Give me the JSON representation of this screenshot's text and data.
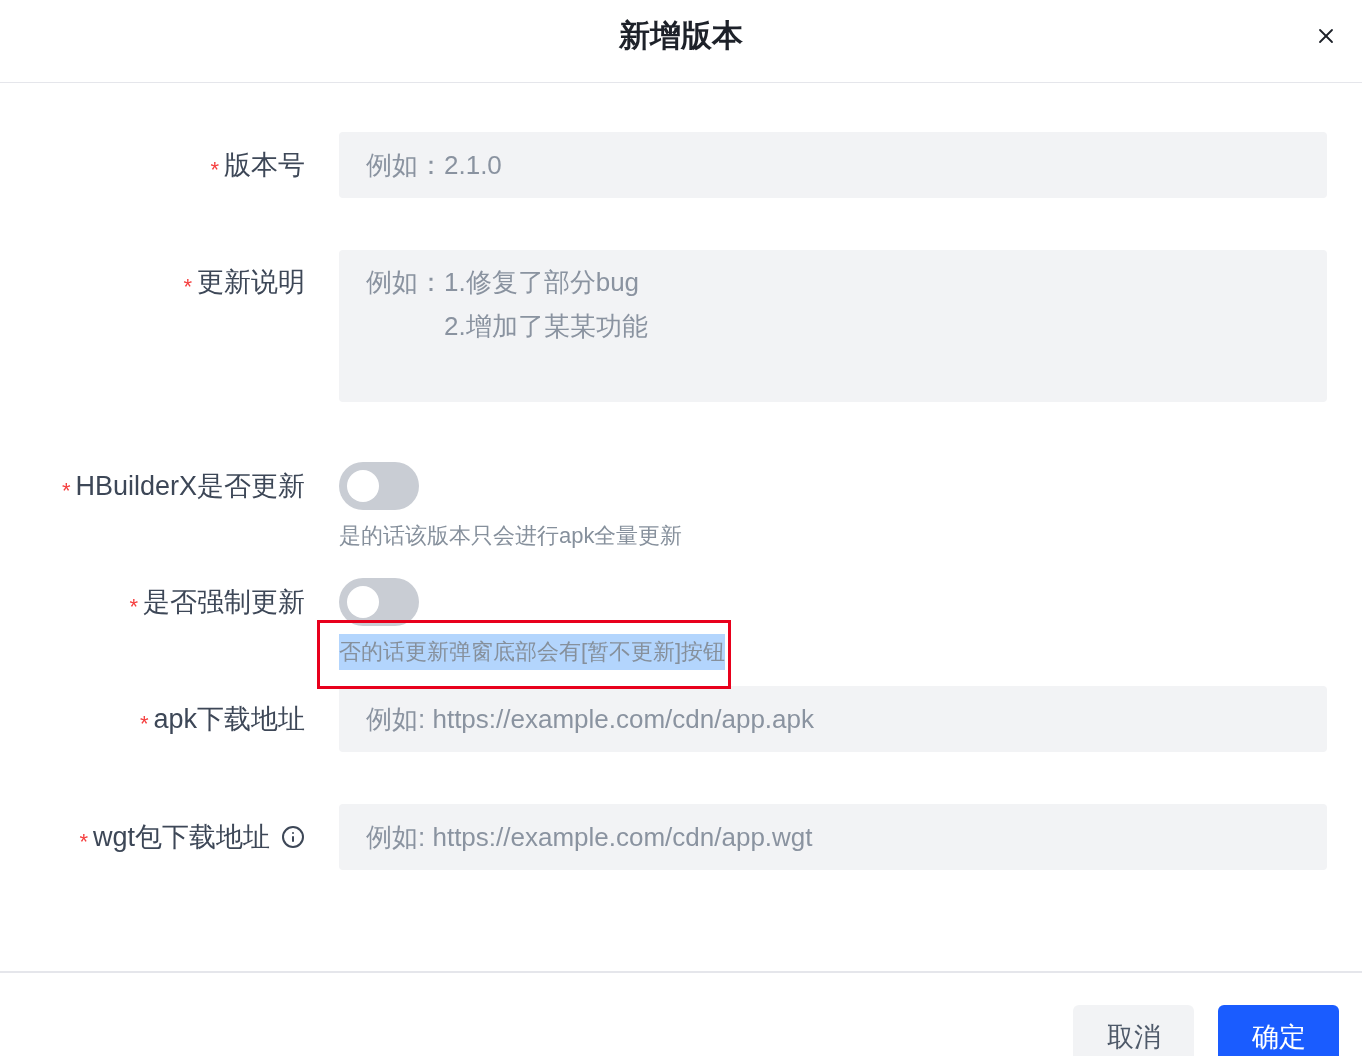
{
  "dialog": {
    "title": "新增版本"
  },
  "form": {
    "items": [
      {
        "kind": "input",
        "label": "版本号",
        "required_mark": "*",
        "info": false,
        "placeholder": "例如：2.1.0"
      },
      {
        "kind": "textarea",
        "label": "更新说明",
        "required_mark": "*",
        "info": false,
        "placeholder": "例如：1.修复了部分bug\n　　　2.增加了某某功能"
      },
      {
        "kind": "switch",
        "label": "HBuilderX是否更新",
        "required_mark": "*",
        "info": false,
        "on": false,
        "hint": {
          "text": "是的话该版本只会进行apk全量更新",
          "selected": false,
          "framed": false
        }
      },
      {
        "kind": "switch",
        "label": "是否强制更新",
        "required_mark": "*",
        "info": false,
        "on": false,
        "hint": {
          "text": "否的话更新弹窗底部会有[暂不更新]按钮",
          "selected": true,
          "framed": true
        }
      },
      {
        "kind": "input",
        "label": "apk下载地址",
        "required_mark": "*",
        "info": false,
        "placeholder": "例如: https://example.com/cdn/app.apk"
      },
      {
        "kind": "input",
        "label": "wgt包下载地址",
        "required_mark": "*",
        "info": true,
        "placeholder": "例如: https://example.com/cdn/app.wgt"
      }
    ]
  },
  "footer": {
    "buttons": [
      {
        "label": "取消",
        "kind": "secondary"
      },
      {
        "label": "确定",
        "kind": "primary"
      }
    ]
  }
}
